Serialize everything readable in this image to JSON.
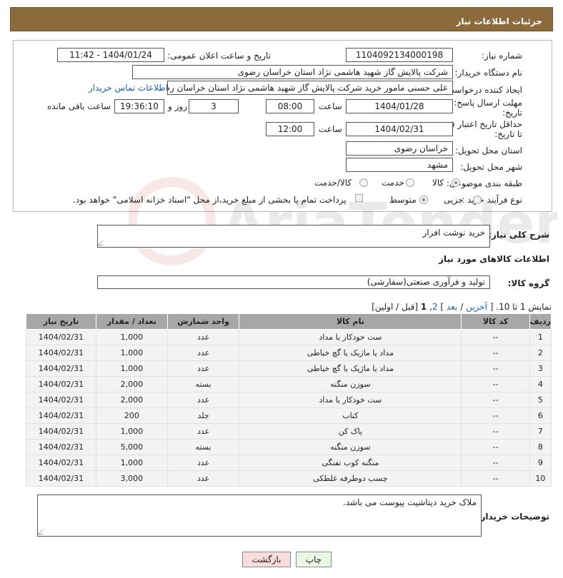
{
  "header": {
    "title": "جزئیات اطلاعات نیاز"
  },
  "fields": {
    "need_number_label": "شماره نیاز:",
    "need_number": "1104092134000198",
    "announce_label": "تاریخ و ساعت اعلان عمومی:",
    "announce_value": "1404/01/24 - 11:42",
    "buyer_org_label": "نام دستگاه خریدار:",
    "buyer_org": "شرکت پالایش گاز شهید هاشمی نژاد   استان خراسان رضوی",
    "creator_label": "ایجاد کننده درخواست:",
    "creator": "علی حسنی مامور خرید شرکت پالایش گاز شهید هاشمی نژاد   استان خراسان رضوی",
    "contact_link": "اطلاعات تماس خریدار",
    "deadline_label_1": "مهلت ارسال پاسخ: تا",
    "deadline_label_2": "تاریخ:",
    "deadline_date": "1404/01/28",
    "time_label": "ساعت",
    "deadline_time": "08:00",
    "days": "3",
    "days_label": "روز و",
    "remaining": "19:36:10",
    "remaining_label": "ساعت باقی مانده",
    "validity_label_1": "حداقل تاریخ اعتبار قیمت:",
    "validity_label_2": "تا تاریخ:",
    "validity_date": "1404/02/31",
    "validity_time": "12:00",
    "province_label": "استان محل تحویل:",
    "province": "خراسان رضوی",
    "city_label": "شهر محل تحویل:",
    "city": "مشهد",
    "category_label": "طبقه بندی موضوعی:",
    "category_options": [
      "کالا",
      "خدمت",
      "کالا/خدمت"
    ],
    "process_label": "نوع فرآیند خرید :",
    "process_options": [
      "جزیی",
      "متوسط"
    ],
    "payment_note": "پرداخت تمام یا بخشی از مبلغ خرید،از محل \"اسناد خزانه اسلامی\" خواهد بود."
  },
  "description": {
    "label": "شرح کلی نیاز:",
    "value": "خرید نوشت افزار"
  },
  "goods_section": {
    "title": "اطلاعات کالاهای مورد نیاز",
    "group_label": "گروه کالا:",
    "group_value": "تولید و فرآوری صنعتی(سفارشی)"
  },
  "pagination": {
    "prefix": "نمایش 1 تا 10. [",
    "last": "آخرین",
    "sep1": "/",
    "next": "بعد",
    "close1": "]",
    "page2": "2",
    "comma": ",",
    "page1": "1",
    "rest": "[قبل / اولین]"
  },
  "table": {
    "headers": [
      "ردیف",
      "کد کالا",
      "نام کالا",
      "واحد شمارش",
      "تعداد / مقدار",
      "تاریخ نیاز"
    ],
    "rows": [
      [
        "1",
        "--",
        "ست خودکار یا مداد",
        "عدد",
        "1,000",
        "1404/02/31"
      ],
      [
        "2",
        "--",
        "مداد یا ماژیک یا گچ خیاطی",
        "عدد",
        "1,000",
        "1404/02/31"
      ],
      [
        "3",
        "--",
        "مداد یا ماژیک یا گچ خیاطی",
        "عدد",
        "1,000",
        "1404/02/31"
      ],
      [
        "4",
        "--",
        "سوزن منگنه",
        "بسته",
        "2,000",
        "1404/02/31"
      ],
      [
        "5",
        "--",
        "ست خودکار یا مداد",
        "عدد",
        "2,000",
        "1404/02/31"
      ],
      [
        "6",
        "--",
        "کتاب",
        "جلد",
        "200",
        "1404/02/31"
      ],
      [
        "7",
        "--",
        "پاک کن",
        "عدد",
        "1,000",
        "1404/02/31"
      ],
      [
        "8",
        "--",
        "سوزن منگنه",
        "بسته",
        "5,000",
        "1404/02/31"
      ],
      [
        "9",
        "--",
        "منگنه کوب تفنگی",
        "عدد",
        "1,000",
        "1404/02/31"
      ],
      [
        "10",
        "--",
        "چسب دوطرفه غلطکی",
        "عدد",
        "3,000",
        "1404/02/31"
      ]
    ]
  },
  "buyer_notes": {
    "label": "توضیحات خریدار:",
    "value": "ملاک خرید دیتاشیت پیوست می باشد."
  },
  "buttons": {
    "print": "چاپ",
    "back": "بازگشت"
  },
  "watermark": "AriaTender.net"
}
